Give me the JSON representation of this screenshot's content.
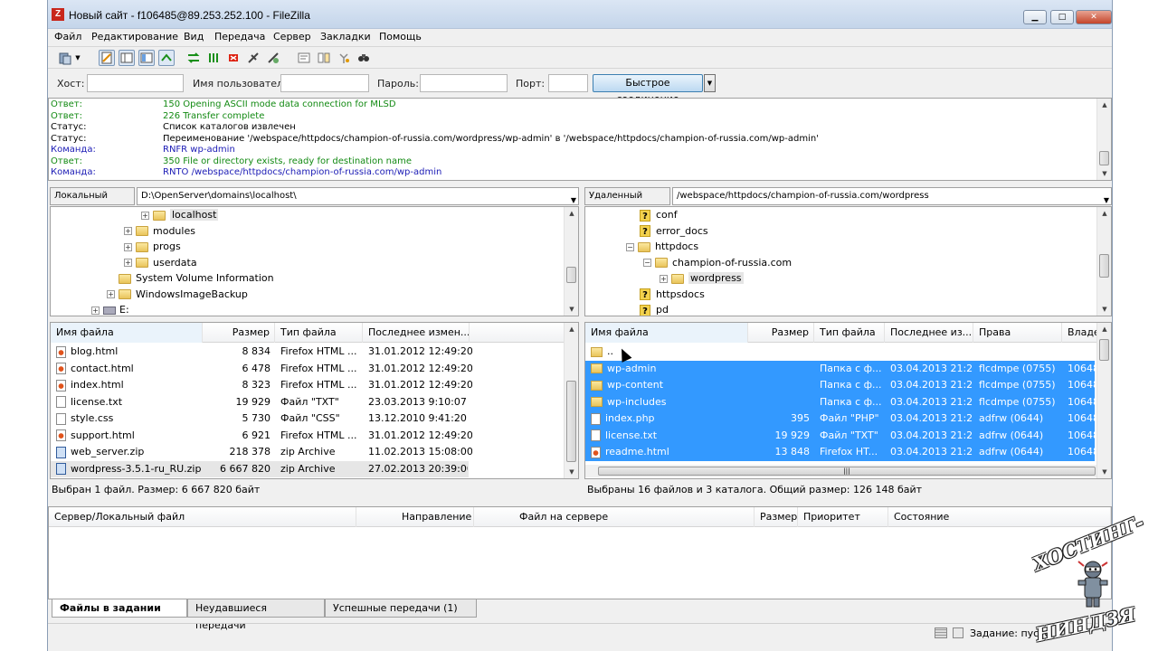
{
  "window": {
    "title": "Новый сайт - f106485@89.253.252.100 - FileZilla",
    "app_icon": "Z",
    "minimize": "▁",
    "maximize": "□",
    "close": "✕"
  },
  "menu": [
    "Файл",
    "Редактирование",
    "Вид",
    "Передача",
    "Сервер",
    "Закладки",
    "Помощь"
  ],
  "toolbar_icons": [
    "site-manager-icon",
    "dropdown-arrow-icon",
    "toggle-log-icon",
    "toggle-local-tree-icon",
    "toggle-remote-tree-icon",
    "toggle-queue-icon",
    "refresh-icon",
    "process-queue-icon",
    "cancel-icon",
    "disconnect-icon",
    "reconnect-icon",
    "filter-icon",
    "compare-icon",
    "sync-browse-icon",
    "search-icon"
  ],
  "quickconnect": {
    "host_label": "Хост:",
    "host_value": "",
    "user_label": "Имя пользователя",
    "user_value": "",
    "pass_label": "Пароль:",
    "pass_value": "",
    "port_label": "Порт:",
    "port_value": "",
    "button": "Быстрое соединение",
    "dropdown": "▼"
  },
  "log": [
    {
      "label": "Ответ:",
      "message": "150 Opening ASCII mode data connection for MLSD",
      "color": "green"
    },
    {
      "label": "Ответ:",
      "message": "226 Transfer complete",
      "color": "green"
    },
    {
      "label": "Статус:",
      "message": "Список каталогов извлечен",
      "color": "black"
    },
    {
      "label": "Статус:",
      "message": "Переименование '/webspace/httpdocs/champion-of-russia.com/wordpress/wp-admin' в '/webspace/httpdocs/champion-of-russia.com/wp-admin'",
      "color": "black"
    },
    {
      "label": "Команда:",
      "message": "RNFR wp-admin",
      "color": "blue"
    },
    {
      "label": "Ответ:",
      "message": "350 File or directory exists, ready for destination name",
      "color": "green"
    },
    {
      "label": "Команда:",
      "message": "RNTO /webspace/httpdocs/champion-of-russia.com/wp-admin",
      "color": "blue"
    }
  ],
  "local": {
    "path_label": "Локальный сайт:",
    "path": "D:\\OpenServer\\domains\\localhost\\",
    "tree": [
      {
        "name": "localhost",
        "indent": 5,
        "expander": "+",
        "selected": true
      },
      {
        "name": "modules",
        "indent": 4,
        "expander": "+"
      },
      {
        "name": "progs",
        "indent": 4,
        "expander": "+"
      },
      {
        "name": "userdata",
        "indent": 4,
        "expander": "+"
      },
      {
        "name": "System Volume Information",
        "indent": 3,
        "expander": ""
      },
      {
        "name": "WindowsImageBackup",
        "indent": 3,
        "expander": "+"
      },
      {
        "name": "E:",
        "indent": 2,
        "expander": "+"
      }
    ],
    "columns": [
      "Имя файла",
      "Размер",
      "Тип файла",
      "Последнее измен..."
    ],
    "files": [
      {
        "name": "blog.html",
        "size": "8 834",
        "type": "Firefox HTML ...",
        "modified": "31.01.2012 12:49:20",
        "icon": "html"
      },
      {
        "name": "contact.html",
        "size": "6 478",
        "type": "Firefox HTML ...",
        "modified": "31.01.2012 12:49:20",
        "icon": "html"
      },
      {
        "name": "index.html",
        "size": "8 323",
        "type": "Firefox HTML ...",
        "modified": "31.01.2012 12:49:20",
        "icon": "html"
      },
      {
        "name": "license.txt",
        "size": "19 929",
        "type": "Файл \"TXT\"",
        "modified": "23.03.2013 9:10:07",
        "icon": "txt"
      },
      {
        "name": "style.css",
        "size": "5 730",
        "type": "Файл \"CSS\"",
        "modified": "13.12.2010 9:41:20",
        "icon": "txt"
      },
      {
        "name": "support.html",
        "size": "6 921",
        "type": "Firefox HTML ...",
        "modified": "31.01.2012 12:49:20",
        "icon": "html"
      },
      {
        "name": "web_server.zip",
        "size": "218 378",
        "type": "zip Archive",
        "modified": "11.02.2013 15:08:00",
        "icon": "zip"
      },
      {
        "name": "wordpress-3.5.1-ru_RU.zip",
        "size": "6 667 820",
        "type": "zip Archive",
        "modified": "27.02.2013 20:39:00",
        "icon": "zip",
        "selected": true
      }
    ],
    "status": "Выбран 1 файл. Размер: 6 667 820 байт"
  },
  "remote": {
    "path_label": "Удаленный сайт:",
    "path": "/webspace/httpdocs/champion-of-russia.com/wordpress",
    "tree": [
      {
        "name": "conf",
        "indent": 3,
        "expander": "",
        "icon": "q"
      },
      {
        "name": "error_docs",
        "indent": 3,
        "expander": "",
        "icon": "q"
      },
      {
        "name": "httpdocs",
        "indent": 3,
        "expander": "−",
        "icon": "folder"
      },
      {
        "name": "champion-of-russia.com",
        "indent": 4,
        "expander": "−",
        "icon": "folder"
      },
      {
        "name": "wordpress",
        "indent": 5,
        "expander": "+",
        "icon": "folder",
        "selected": true
      },
      {
        "name": "httpsdocs",
        "indent": 3,
        "expander": "",
        "icon": "q"
      },
      {
        "name": "pd",
        "indent": 3,
        "expander": "",
        "icon": "q"
      }
    ],
    "columns": [
      "Имя файла",
      "Размер",
      "Тип файла",
      "Последнее из...",
      "Права",
      "Владе"
    ],
    "files": [
      {
        "name": "..",
        "size": "",
        "type": "",
        "modified": "",
        "perms": "",
        "owner": "",
        "icon": "folderi"
      },
      {
        "name": "wp-admin",
        "size": "",
        "type": "Папка с ф...",
        "modified": "03.04.2013 21:2...",
        "perms": "flcdmpe (0755)",
        "owner": "10648",
        "icon": "folderi",
        "selected": true
      },
      {
        "name": "wp-content",
        "size": "",
        "type": "Папка с ф...",
        "modified": "03.04.2013 21:2...",
        "perms": "flcdmpe (0755)",
        "owner": "10648",
        "icon": "folderi",
        "selected": true
      },
      {
        "name": "wp-includes",
        "size": "",
        "type": "Папка с ф...",
        "modified": "03.04.2013 21:2...",
        "perms": "flcdmpe (0755)",
        "owner": "10648",
        "icon": "folderi",
        "selected": true
      },
      {
        "name": "index.php",
        "size": "395",
        "type": "Файл \"PHP\"",
        "modified": "03.04.2013 21:2...",
        "perms": "adfrw (0644)",
        "owner": "10648",
        "icon": "txt",
        "selected": true
      },
      {
        "name": "license.txt",
        "size": "19 929",
        "type": "Файл \"TXT\"",
        "modified": "03.04.2013 21:2...",
        "perms": "adfrw (0644)",
        "owner": "10648",
        "icon": "txt",
        "selected": true
      },
      {
        "name": "readme.html",
        "size": "13 848",
        "type": "Firefox HT...",
        "modified": "03.04.2013 21:2...",
        "perms": "adfrw (0644)",
        "owner": "10648",
        "icon": "html",
        "selected": true
      }
    ],
    "status": "Выбраны 16 файлов и 3 каталога. Общий размер: 126 148 байт"
  },
  "queue": {
    "columns": [
      "Сервер/Локальный файл",
      "Направление",
      "Файл на сервере",
      "Размер",
      "Приоритет",
      "Состояние"
    ],
    "tabs": [
      "Файлы в задании",
      "Неудавшиеся передачи",
      "Успешные передачи (1)"
    ]
  },
  "statusbar": {
    "text": "Задание: пусто"
  },
  "watermark": {
    "top": "ХОСТИНГ-",
    "bottom": "НИНДЗЯ"
  }
}
